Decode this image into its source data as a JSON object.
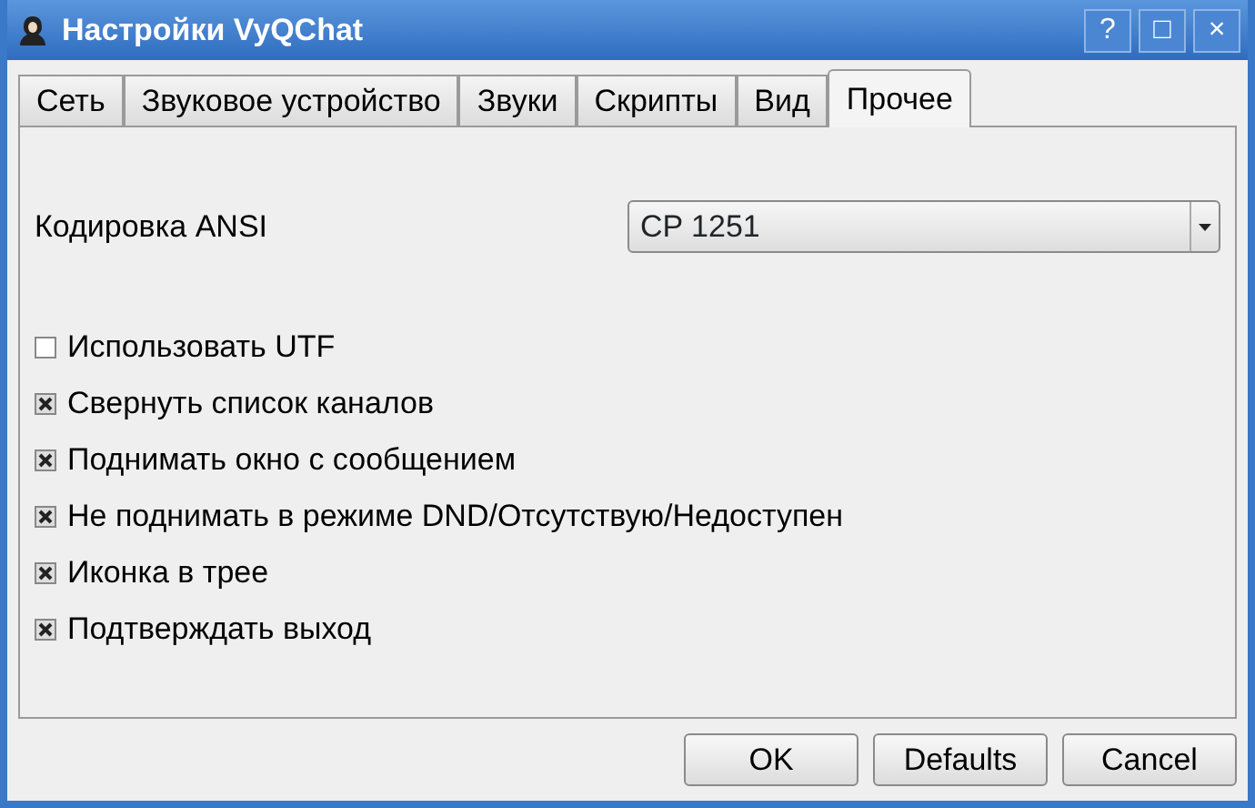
{
  "window": {
    "title": "Настройки VyQChat",
    "buttons": [
      "?",
      "□",
      "×"
    ]
  },
  "tabs": [
    {
      "label": "Сеть",
      "selected": false
    },
    {
      "label": "Звуковое устройство",
      "selected": false
    },
    {
      "label": "Звуки",
      "selected": false
    },
    {
      "label": "Скрипты",
      "selected": false
    },
    {
      "label": "Вид",
      "selected": false
    },
    {
      "label": "Прочее",
      "selected": true
    }
  ],
  "encoding": {
    "label": "Кодировка ANSI",
    "value": "CP 1251"
  },
  "options": [
    {
      "label": "Использовать UTF",
      "checked": false
    },
    {
      "label": "Свернуть список каналов",
      "checked": true
    },
    {
      "label": "Поднимать окно с сообщением",
      "checked": true
    },
    {
      "label": "Не поднимать в режиме DND/Отсутствую/Недоступен",
      "checked": true
    },
    {
      "label": "Иконка в трее",
      "checked": true
    },
    {
      "label": "Подтверждать выход",
      "checked": true
    }
  ],
  "buttons": [
    "OK",
    "Defaults",
    "Cancel"
  ]
}
